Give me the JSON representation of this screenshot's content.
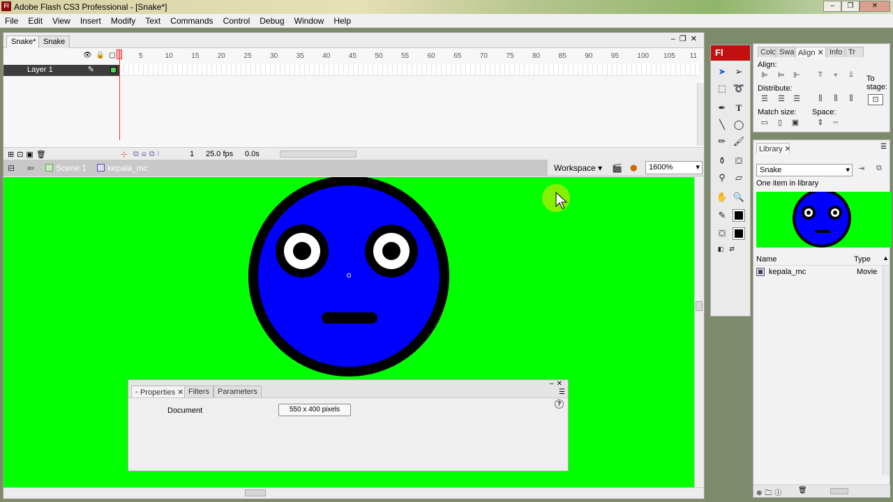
{
  "window": {
    "title": "Adobe Flash CS3 Professional - [Snake*]",
    "app_icon": "Fl",
    "minimize": "–",
    "maximize": "❐",
    "close": "✕"
  },
  "menu": [
    "File",
    "Edit",
    "View",
    "Insert",
    "Modify",
    "Text",
    "Commands",
    "Control",
    "Debug",
    "Window",
    "Help"
  ],
  "doc_tabs": [
    "Snake*",
    "Snake"
  ],
  "timeline": {
    "layer_name": "Layer 1",
    "ruler": [
      "5",
      "10",
      "15",
      "20",
      "25",
      "30",
      "35",
      "40",
      "45",
      "50",
      "55",
      "60",
      "65",
      "70",
      "75",
      "80",
      "85",
      "90",
      "95",
      "100",
      "105",
      "11"
    ],
    "current_frame": "1",
    "frame_rate": "25.0 fps",
    "elapsed": "0.0s"
  },
  "editbar": {
    "scene": "Scene 1",
    "symbol": "kepala_mc",
    "workspace": "Workspace",
    "zoom": "1600%"
  },
  "properties": {
    "tabs": [
      "Properties",
      "Filters",
      "Parameters"
    ],
    "doc_label": "Document",
    "doc_size": "550 x 400 pixels",
    "help": "?"
  },
  "tools_panel": {
    "logo": "Fl",
    "icons": [
      "selection-arrow-icon",
      "subselect-arrow-icon",
      "free-transform-icon",
      "lasso-icon",
      "pen-icon",
      "text-tool-icon",
      "line-tool-icon",
      "oval-tool-icon",
      "pencil-icon",
      "brush-icon",
      "ink-bottle-icon",
      "paint-bucket-icon",
      "eyedropper-icon",
      "eraser-icon",
      "hand-tool-icon",
      "zoom-tool-icon",
      "stroke-color-icon",
      "fill-color-icon"
    ]
  },
  "align_panel": {
    "tabs": [
      "Color",
      "Swat",
      "Align",
      "Info",
      "Tr"
    ],
    "align_label": "Align:",
    "distribute_label": "Distribute:",
    "match_size_label": "Match size:",
    "space_label": "Space:",
    "to_stage_label": "To\nstage:"
  },
  "library": {
    "tab": "Library",
    "document": "Snake",
    "item_count": "One item in library",
    "col_name": "Name",
    "col_type": "Type",
    "items": [
      {
        "name": "kepala_mc",
        "type": "Movie"
      }
    ]
  },
  "colors": {
    "stage": "#00ff00",
    "face": "#0000ff",
    "outline": "#000000",
    "flash_red": "#c01010"
  }
}
